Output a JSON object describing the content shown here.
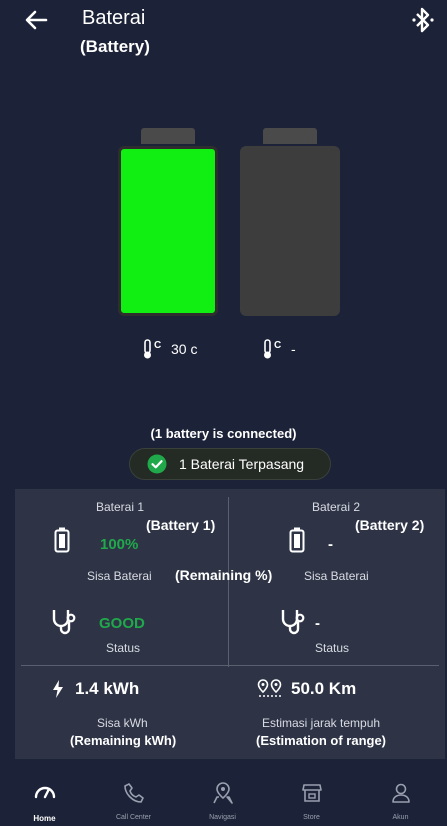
{
  "header": {
    "title": "Baterai",
    "subtitle": "(Battery)"
  },
  "batteries": [
    {
      "temperature": "30 c",
      "fill_color": "#11ee11"
    },
    {
      "temperature": "-",
      "fill_color": "#3d3d3d"
    }
  ],
  "connection": {
    "note": "(1 battery is connected)",
    "status": "1 Baterai Terpasang"
  },
  "panel": {
    "battery1": {
      "header": "Baterai 1",
      "header_en": "(Battery 1)",
      "percent": "100%",
      "percent_label": "Sisa Baterai",
      "percent_label_en": "(Remaining %)",
      "health": "GOOD",
      "status_label": "Status"
    },
    "battery2": {
      "header": "Baterai 2",
      "header_en": "(Battery 2)",
      "percent": "-",
      "percent_label": "Sisa Baterai",
      "health": "-",
      "status_label": "Status"
    },
    "energy": {
      "value": "1.4 kWh",
      "label": "Sisa kWh",
      "label_en": "(Remaining kWh)"
    },
    "range": {
      "value": "50.0 Km",
      "label": "Estimasi jarak tempuh",
      "label_en": "(Estimation of range)"
    }
  },
  "nav": [
    {
      "label": "Home",
      "icon": "speedometer-icon",
      "active": true
    },
    {
      "label": "Call Center",
      "icon": "phone-icon"
    },
    {
      "label": "Navigasi",
      "icon": "map-pin-icon"
    },
    {
      "label": "Store",
      "icon": "store-icon"
    },
    {
      "label": "Akun",
      "icon": "user-icon"
    }
  ],
  "colors": {
    "background": "#1c2237",
    "panel": "#2e3446",
    "accent_green": "#1fa94a",
    "battery_green": "#11ee11"
  }
}
